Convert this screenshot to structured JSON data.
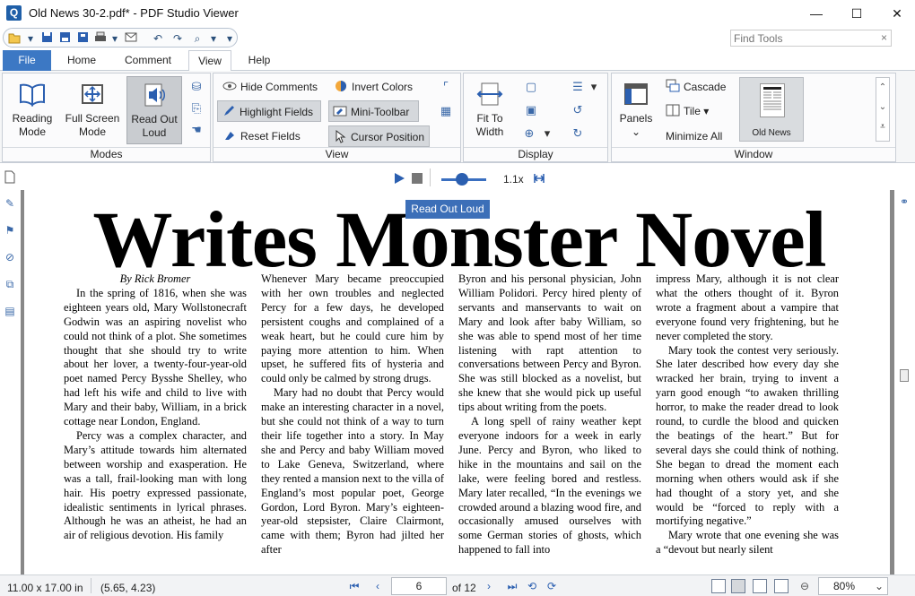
{
  "window": {
    "title": "Old News 30-2.pdf* - PDF Studio Viewer",
    "app_icon": "Q",
    "min_glyph": "—",
    "max_glyph": "☐",
    "close_glyph": "✕"
  },
  "find_tools": {
    "placeholder": "Find Tools",
    "clear": "×"
  },
  "tabs": [
    {
      "label": "File"
    },
    {
      "label": "Home"
    },
    {
      "label": "Comment"
    },
    {
      "label": "View"
    },
    {
      "label": "Help"
    }
  ],
  "ribbon": {
    "modes": {
      "label": "Modes",
      "reading_mode": "Reading\nMode",
      "full_screen": "Full Screen\nMode",
      "read_out_loud": "Read Out\nLoud"
    },
    "view": {
      "label": "View",
      "hide_comments": "Hide Comments",
      "invert_colors": "Invert Colors",
      "highlight_fields": "Highlight Fields",
      "mini_toolbar": "Mini-Toolbar",
      "reset_fields": "Reset Fields",
      "cursor_position": "Cursor Position"
    },
    "display": {
      "label": "Display",
      "fit_to_width": "Fit To\nWidth"
    },
    "window": {
      "label": "Window",
      "panels": "Panels",
      "cascade": "Cascade",
      "tile": "Tile",
      "minimize_all": "Minimize All",
      "thumb_label": "Old News"
    }
  },
  "read_out_loud": {
    "speed": "1.1x",
    "tooltip": "Read Out Loud",
    "speed_fraction": 0.45
  },
  "document": {
    "headline": "Writes Monster Novel",
    "byline": "By Rick Bromer",
    "col1": [
      "In the spring of 1816, when she was eighteen years old, Mary Wollstonecraft Godwin was an aspiring novelist who could not think of a plot. She sometimes thought that she should try to write about her lover, a twenty-four-year-old poet named Percy Bysshe Shelley, who had left his wife and child to live with Mary and their baby, William, in a brick cottage near London, England.",
      "Percy was a complex character, and Mary’s attitude towards him alternated between worship and exasperation. He was a tall, frail-looking man with long hair. His poetry expressed passionate, idealistic sentiments in lyrical phrases. Although he was an atheist, he had an air of religious devotion. His family"
    ],
    "col2": [
      "Whenever Mary became preoccupied with her own troubles and neglected Percy for a few days, he developed persistent coughs and complained of a weak heart, but he could cure him by paying more attention to him. When upset, he suffered fits of hysteria and could only be calmed by strong drugs.",
      "Mary had no doubt that Percy would make an interesting character in a novel, but she could not think of a way to turn their life together into a story. In May she and Percy and baby William moved to Lake Geneva, Switzerland, where they rented a mansion next to the villa of England’s most popular poet, George Gordon, Lord Byron. Mary’s eighteen-year-old stepsister, Claire Clairmont, came with them; Byron had jilted her after"
    ],
    "col3": [
      "Byron and his personal physician, John William Polidori. Percy hired plenty of servants and manservants to wait on Mary and look after baby William, so she was able to spend most of her time listening with rapt attention to conversations between Percy and Byron. She was still blocked as a novelist, but she knew that she would pick up useful tips about writing from the poets.",
      "A long spell of rainy weather kept everyone indoors for a week in early June. Percy and Byron, who liked to hike in the mountains and sail on the lake, were feeling bored and restless. Mary later recalled, “In the evenings we crowded around a blazing wood fire, and occasionally amused ourselves with some German stories of ghosts, which happened to fall into"
    ],
    "col4": [
      "impress Mary, although it is not clear what the others thought of it. Byron wrote a fragment about a vampire that everyone found very frightening, but he never completed the story.",
      "Mary took the contest very seriously. She later described how every day she wracked her brain, trying to invent a yarn good enough “to awaken thrilling horror, to make the reader dread to look round, to curdle the blood and quicken the beatings of the heart.” But for several days she could think of nothing. She began to dread the moment each morning when others would ask if she had thought of a story yet, and she would be “forced to reply with a mortifying negative.”",
      "Mary wrote that one evening she was a “devout but nearly silent"
    ]
  },
  "status": {
    "page_size": "11.00 x 17.00 in",
    "cursor": "(5.65, 4.23)",
    "current_page": "6",
    "of_pages": "of 12",
    "zoom": "80%"
  },
  "colors": {
    "accent": "#3c78c4",
    "tooltip": "#3c6fb8",
    "pdf_gray": "#888888"
  }
}
